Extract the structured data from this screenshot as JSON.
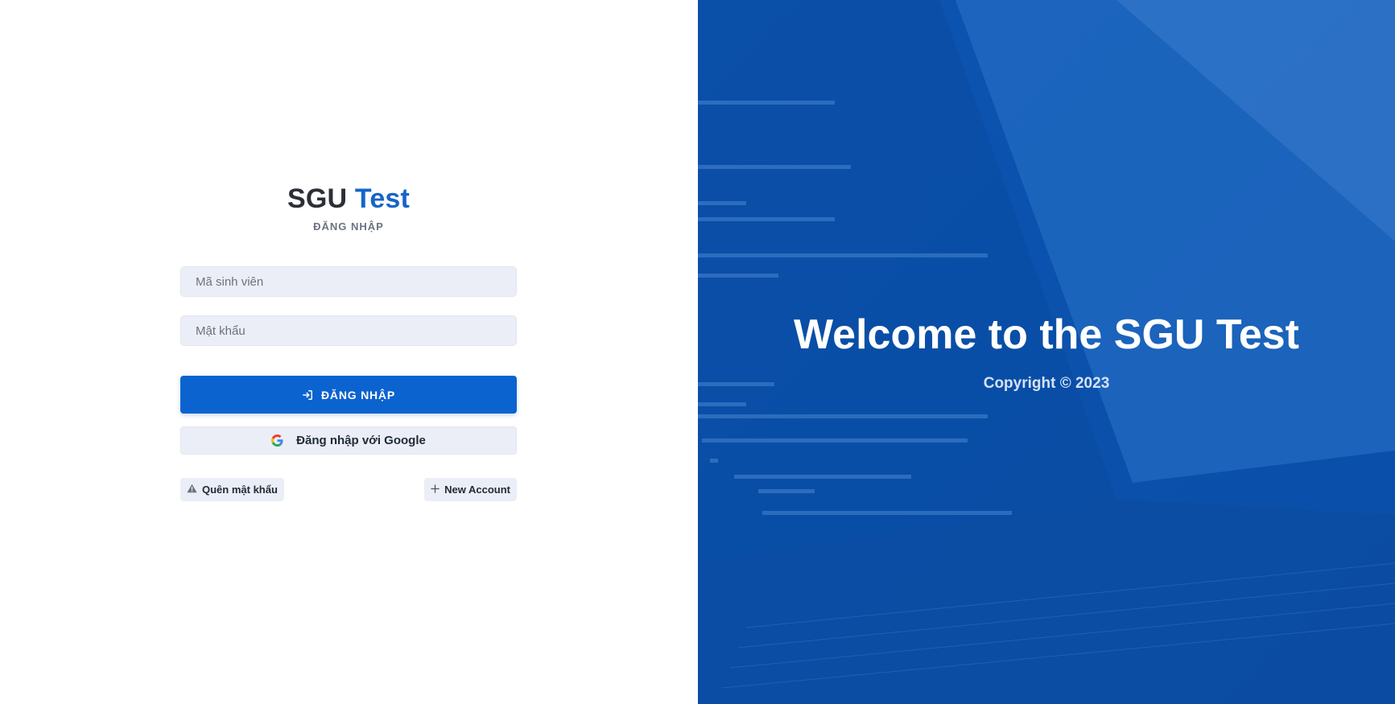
{
  "brand": {
    "name_part1": "SGU",
    "name_part2": "Test",
    "subtitle": "ĐĂNG NHẬP"
  },
  "form": {
    "student_id_placeholder": "Mã sinh viên",
    "password_placeholder": "Mật khẩu",
    "login_button": "ĐĂNG NHẬP",
    "login_icon": "login-arrow-icon",
    "google_button": "Đăng nhập với Google",
    "google_icon": "google-icon"
  },
  "links": {
    "forgot_password": "Quên mật khẩu",
    "forgot_icon": "warning-icon",
    "new_account": "New Account",
    "new_account_icon": "plus-icon"
  },
  "hero": {
    "welcome": "Welcome to the SGU Test",
    "copyright": "Copyright © 2023"
  },
  "colors": {
    "accent": "#1565c8",
    "primary_button": "#0b63cf",
    "hero_overlay": "#0d58b8",
    "input_bg": "#ebeef6"
  }
}
